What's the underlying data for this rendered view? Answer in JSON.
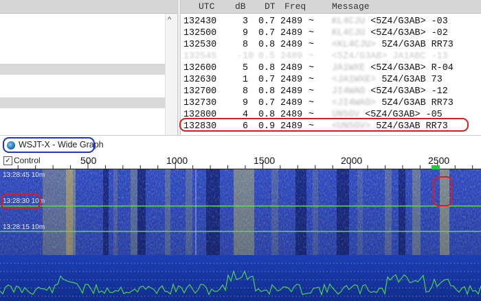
{
  "decode_table": {
    "columns": {
      "utc": "UTC",
      "db": "dB",
      "dt": "DT",
      "freq": "Freq",
      "message": "Message"
    },
    "rows": [
      {
        "utc": "132430",
        "db": "3",
        "dt": "0.7",
        "freq": "2489",
        "tilde": "~",
        "call": "KL4CJU",
        "message": "<5Z4/G3AB> -03",
        "faded": false
      },
      {
        "utc": "132500",
        "db": "9",
        "dt": "0.7",
        "freq": "2489",
        "tilde": "~",
        "call": "KL4CJU",
        "message": "<5Z4/G3AB> -02",
        "faded": false
      },
      {
        "utc": "132530",
        "db": "8",
        "dt": "0.8",
        "freq": "2489",
        "tilde": "~",
        "call": "<KL4CJU>",
        "message": "5Z4/G3AB RR73",
        "faded": false
      },
      {
        "utc": "132545",
        "db": "-10",
        "dt": "0.5",
        "freq": "2489",
        "tilde": "~",
        "call": "<5Z4/G3AB> JA1ABC -13",
        "message": "",
        "faded": true
      },
      {
        "utc": "132600",
        "db": "5",
        "dt": "0.8",
        "freq": "2489",
        "tilde": "~",
        "call": "JA1WXE",
        "message": "<5Z4/G3AB> R-04",
        "faded": false
      },
      {
        "utc": "132630",
        "db": "1",
        "dt": "0.7",
        "freq": "2489",
        "tilde": "~",
        "call": "<JA1WXE>",
        "message": "5Z4/G3AB 73",
        "faded": false
      },
      {
        "utc": "132700",
        "db": "8",
        "dt": "0.8",
        "freq": "2489",
        "tilde": "~",
        "call": "JI4WAO",
        "message": "<5Z4/G3AB> -12",
        "faded": false
      },
      {
        "utc": "132730",
        "db": "9",
        "dt": "0.7",
        "freq": "2489",
        "tilde": "~",
        "call": "<JI4WAO>",
        "message": "5Z4/G3AB RR73",
        "faded": false
      },
      {
        "utc": "132800",
        "db": "4",
        "dt": "0.8",
        "freq": "2489",
        "tilde": "~",
        "call": "UN5GV",
        "message": "<5Z4/G3AB> -05",
        "faded": false
      },
      {
        "utc": "132830",
        "db": "6",
        "dt": "0.9",
        "freq": "2489",
        "tilde": "~",
        "call": "<UN5GV>",
        "message": "5Z4/G3AB RR73",
        "faded": false
      }
    ]
  },
  "wide_graph": {
    "title": "WSJT-X - Wide Graph",
    "control_label": "Control",
    "freq_ticks": [
      "500",
      "1000",
      "1500",
      "2000",
      "2500"
    ],
    "timestamps": [
      {
        "time": "13:28:45",
        "label": "10m"
      },
      {
        "time": "13:28:30",
        "label": "10m"
      },
      {
        "time": "13:28:15",
        "label": "10m"
      }
    ]
  },
  "colors": {
    "highlight_red": "#e01a1a",
    "highlight_blue": "#1536d8",
    "waterfall_base": "#1f3bb8",
    "signal_yellow": "#f2e84a",
    "spectrum_line": "#4fd24f",
    "marker_green": "#22cc33"
  }
}
